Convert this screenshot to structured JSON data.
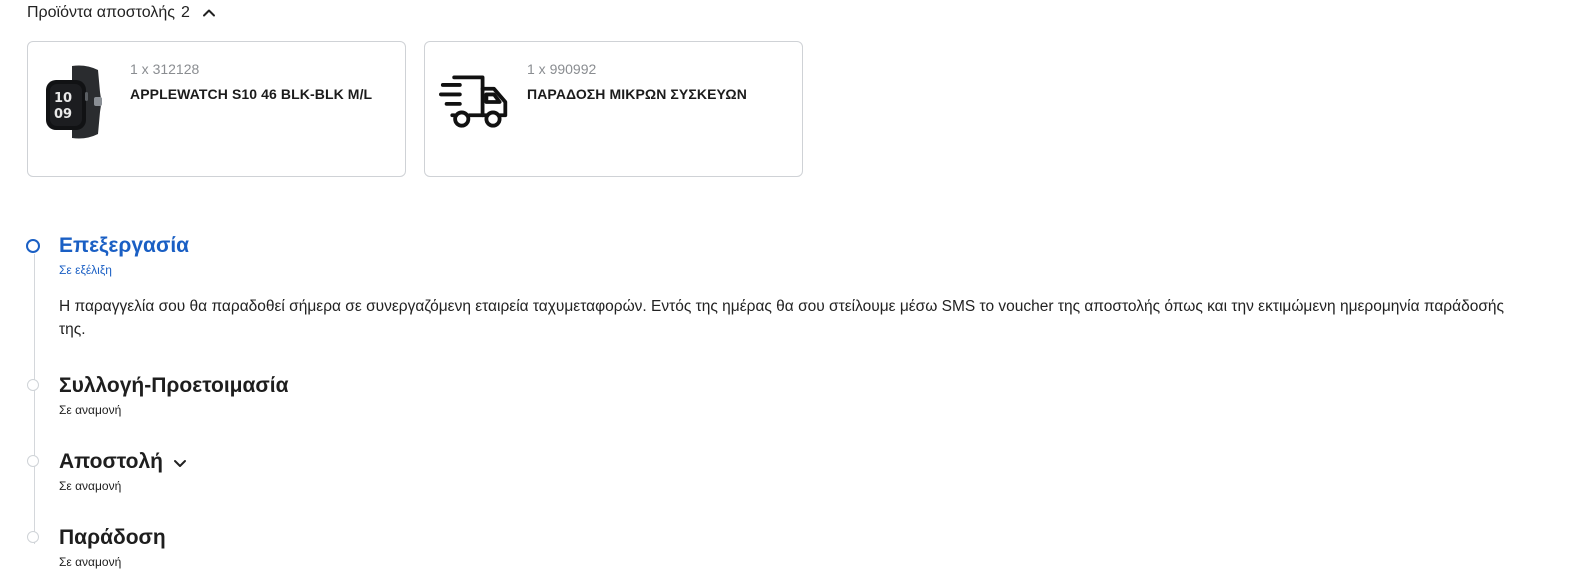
{
  "products": {
    "header_label": "Προϊόντα αποστολής",
    "count": "2",
    "expanded_icon": "chevron-up-icon",
    "items": [
      {
        "qty_line": "1 x 312128",
        "name": "APPLEWATCH S10 46 BLK-BLK M/L",
        "icon": "smartwatch-image"
      },
      {
        "qty_line": "1 x 990992",
        "name": "ΠΑΡΑΔΟΣΗ ΜΙΚΡΩΝ ΣΥΣΚΕΥΩΝ",
        "icon": "delivery-truck-icon"
      }
    ]
  },
  "timeline": {
    "colors": {
      "active": "#1a5fc4",
      "inactive": "#cfd3d7",
      "text": "#1e1e1e"
    },
    "steps": [
      {
        "title": "Επεξεργασία",
        "status": "Σε εξέλιξη",
        "description": "Η παραγγελία σου θα παραδοθεί σήμερα σε συνεργαζόμενη εταιρεία ταχυμεταφορών. Εντός της ημέρας θα σου στείλουμε μέσω SMS το voucher της αποστολής όπως και την εκτιμώμενη ημερομηνία παράδοσής της.",
        "state": "active"
      },
      {
        "title": "Συλλογή-Προετοιμασία",
        "status": "Σε αναμονή",
        "state": "pending"
      },
      {
        "title": "Αποστολή",
        "status": "Σε αναμονή",
        "state": "pending",
        "expand_icon": "chevron-down-icon"
      },
      {
        "title": "Παράδοση",
        "status": "Σε αναμονή",
        "state": "pending"
      }
    ]
  }
}
